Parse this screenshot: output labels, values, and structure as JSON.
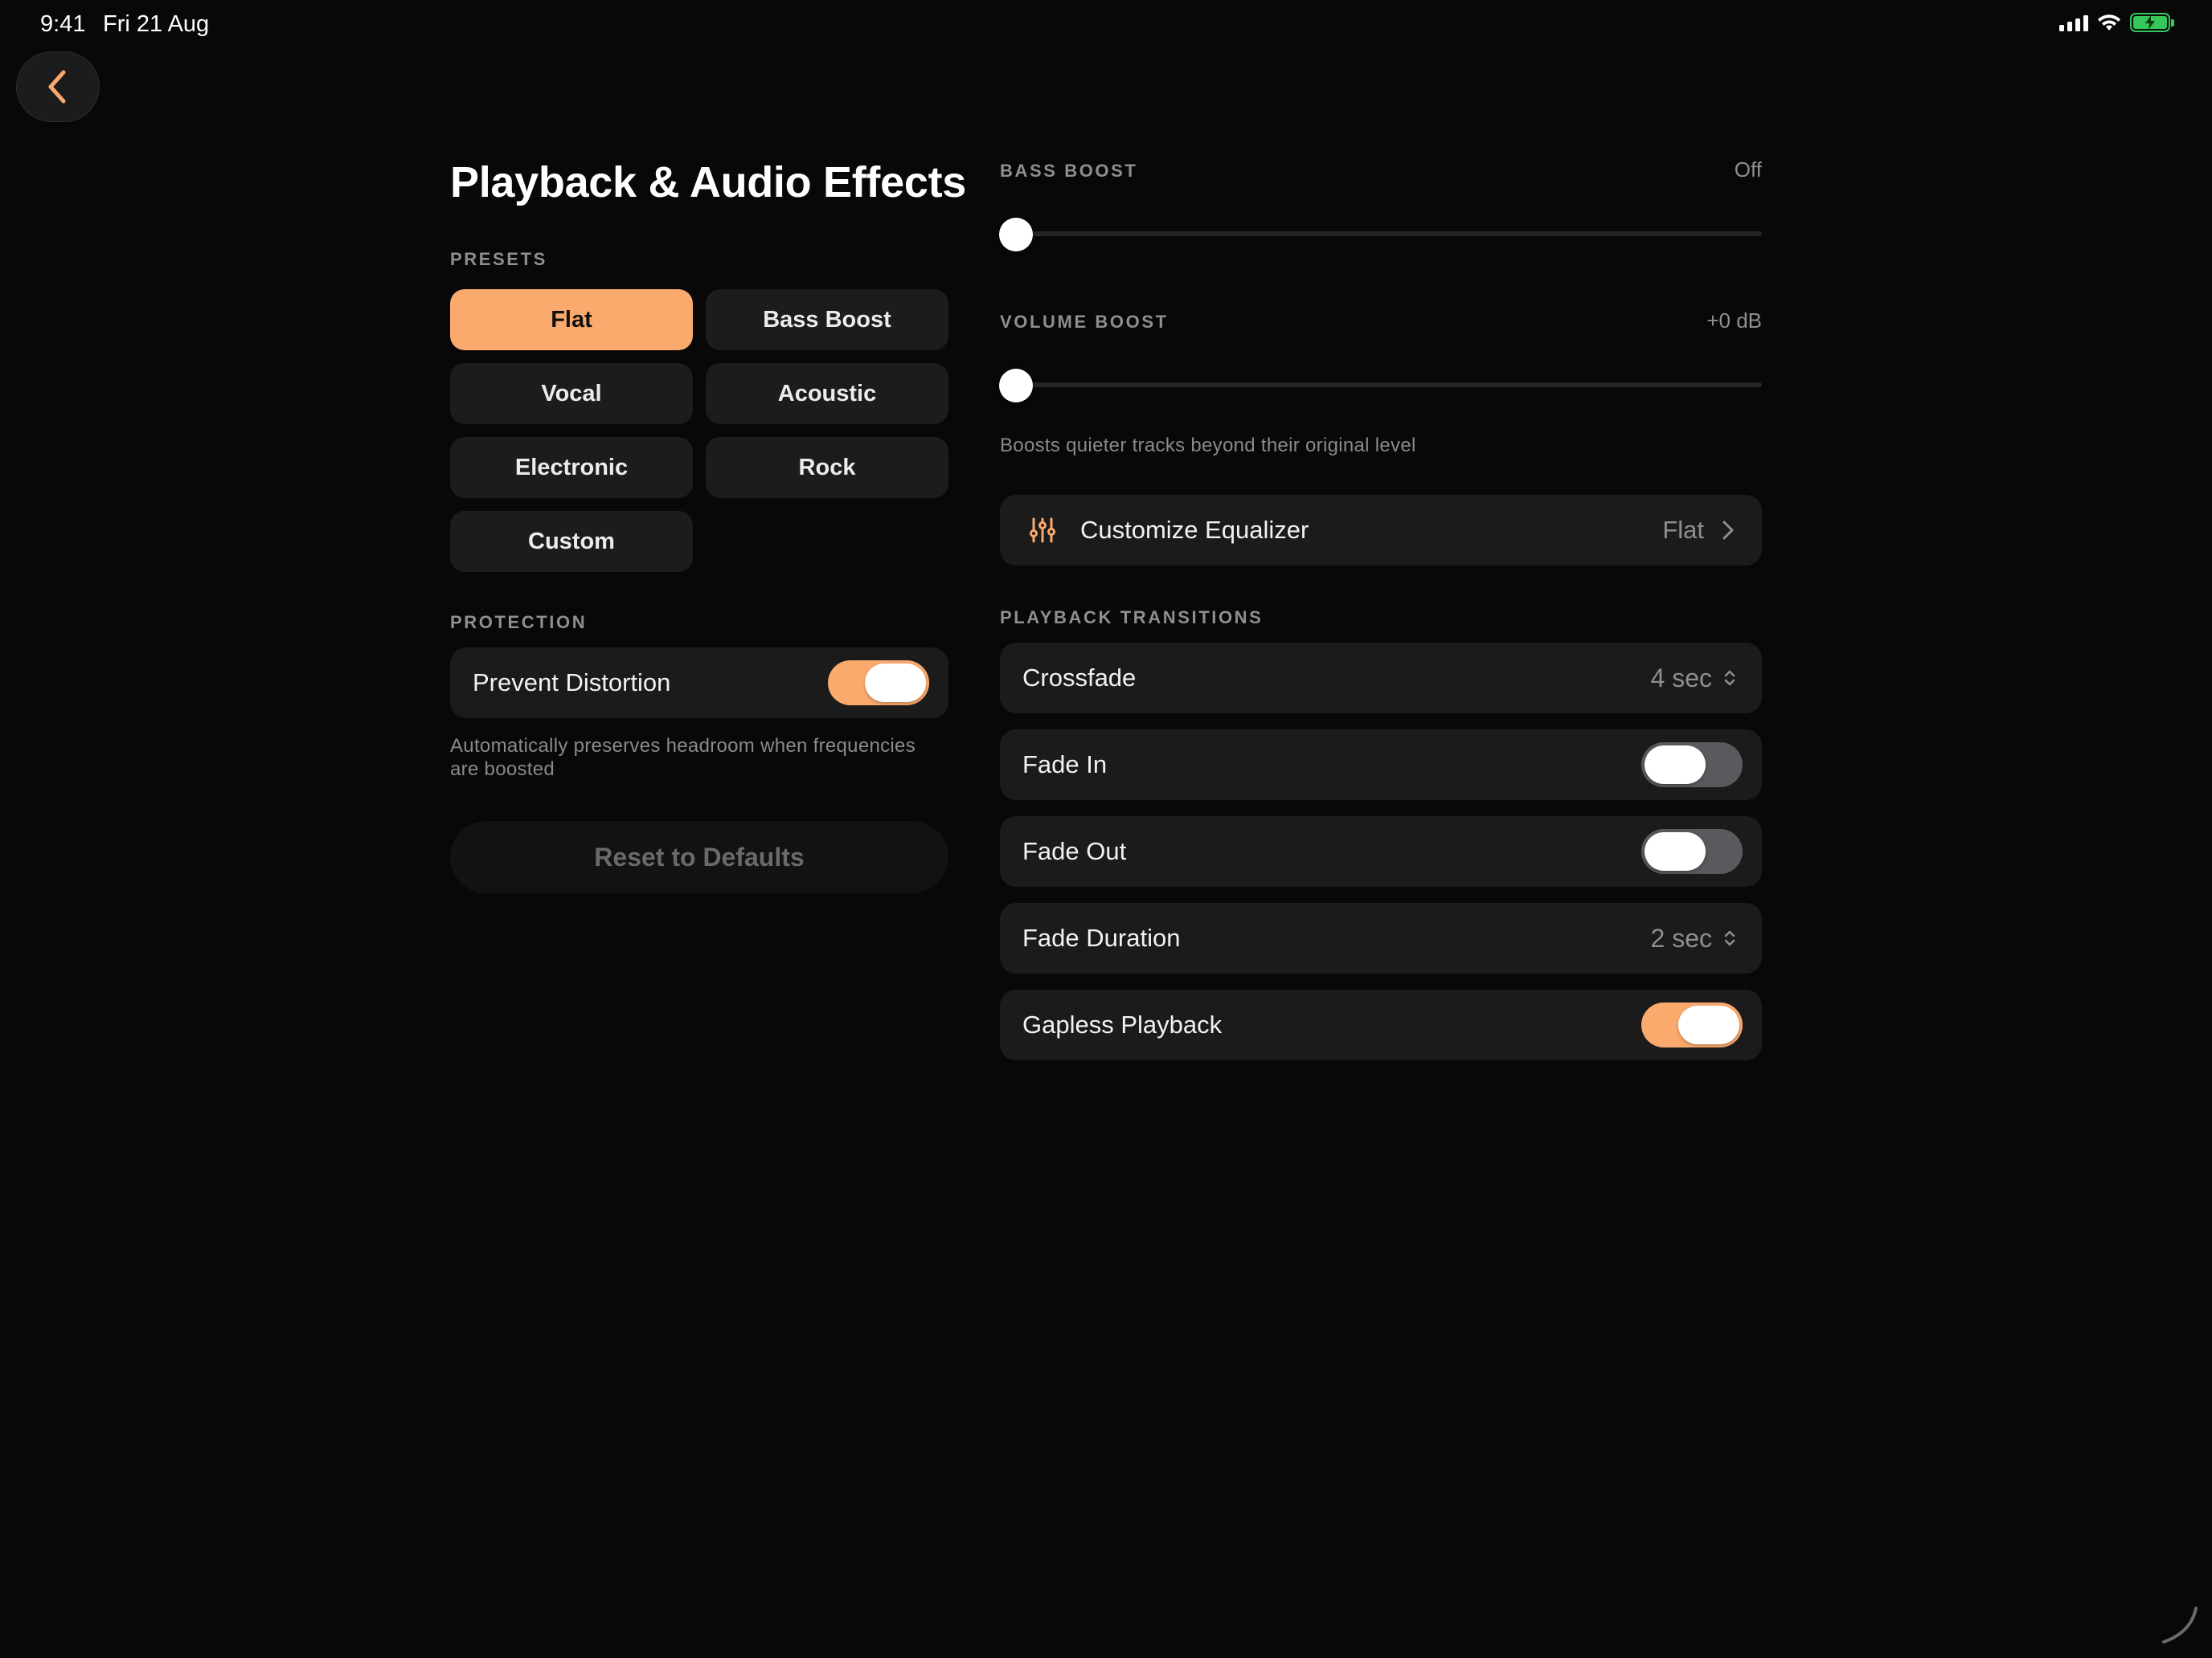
{
  "status_bar": {
    "time": "9:41",
    "date": "Fri 21 Aug",
    "icons": [
      "cellular-signal-icon",
      "wifi-icon",
      "battery-charging-icon"
    ]
  },
  "nav": {
    "back_icon": "chevron-left-icon"
  },
  "title": "Playback & Audio Effects",
  "presets": {
    "label": "PRESETS",
    "items": [
      {
        "label": "Flat",
        "selected": true
      },
      {
        "label": "Bass Boost",
        "selected": false
      },
      {
        "label": "Vocal",
        "selected": false
      },
      {
        "label": "Acoustic",
        "selected": false
      },
      {
        "label": "Electronic",
        "selected": false
      },
      {
        "label": "Rock",
        "selected": false
      },
      {
        "label": "Custom",
        "selected": false
      }
    ]
  },
  "protection": {
    "label": "PROTECTION",
    "prevent_distortion": {
      "label": "Prevent Distortion",
      "on": true
    },
    "helper": "Automatically preserves headroom when frequencies are boosted"
  },
  "reset_label": "Reset to Defaults",
  "bass_boost": {
    "label": "BASS BOOST",
    "value": "Off",
    "level": 0
  },
  "volume_boost": {
    "label": "VOLUME BOOST",
    "value": "+0 dB",
    "level": 0,
    "helper": "Boosts quieter tracks beyond their original level"
  },
  "equalizer": {
    "icon": "sliders-icon",
    "label": "Customize Equalizer",
    "value": "Flat"
  },
  "transitions": {
    "label": "PLAYBACK TRANSITIONS",
    "crossfade": {
      "label": "Crossfade",
      "value": "4 sec"
    },
    "fade_in": {
      "label": "Fade In",
      "on": false
    },
    "fade_out": {
      "label": "Fade Out",
      "on": false
    },
    "fade_duration": {
      "label": "Fade Duration",
      "value": "2 sec"
    },
    "gapless": {
      "label": "Gapless Playback",
      "on": true
    }
  },
  "colors": {
    "accent": "#fbaa6e",
    "background": "#080808",
    "card": "#1b1b1b",
    "secondary_text": "#8e8e93"
  }
}
